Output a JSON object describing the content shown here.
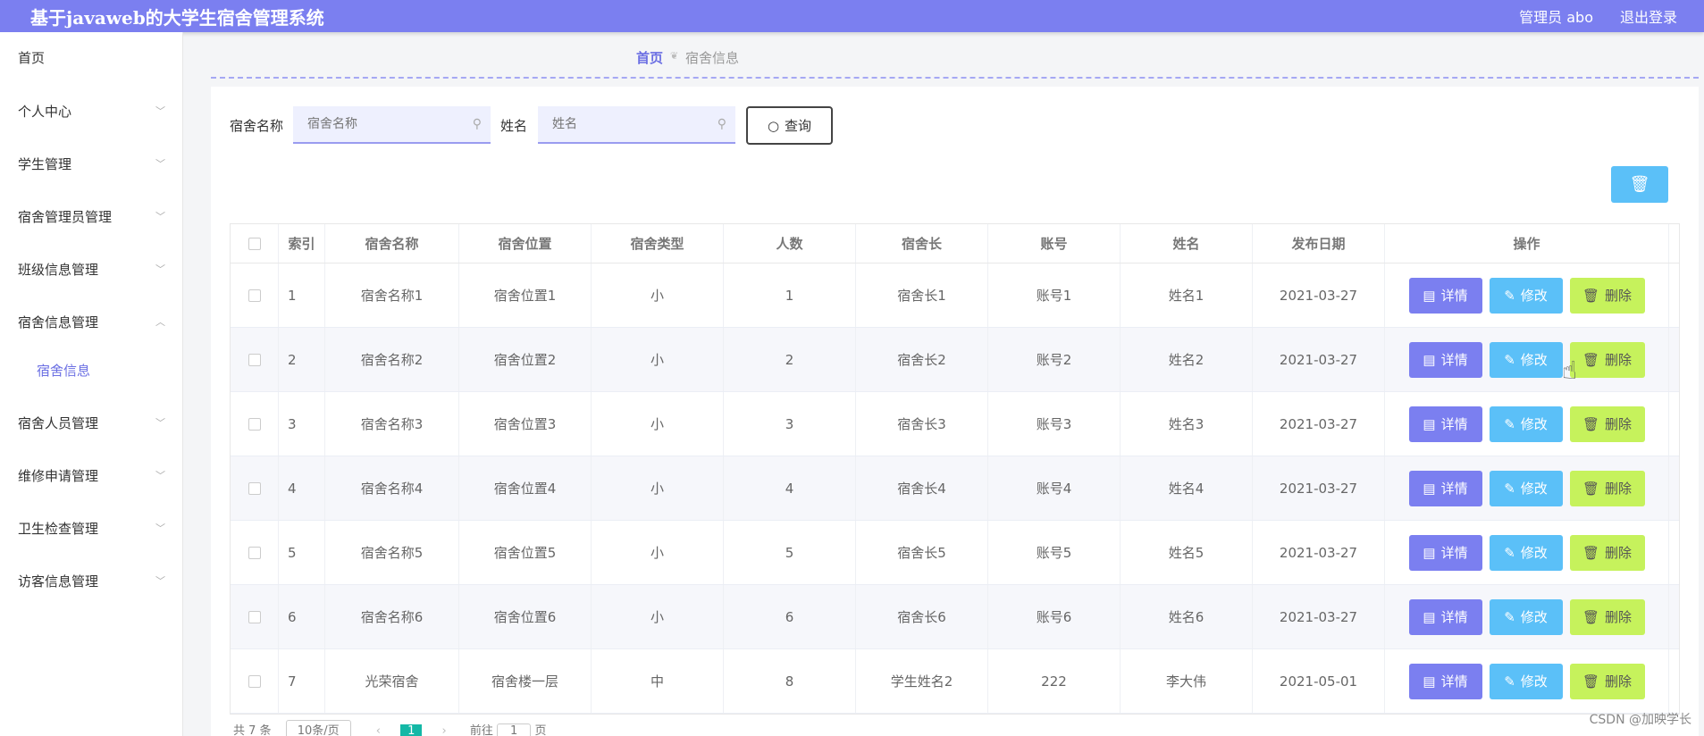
{
  "header": {
    "title": "基于javaweb的大学生宿舍管理系统",
    "user": "管理员 abo",
    "logout": "退出登录"
  },
  "sidebar": {
    "items": [
      {
        "label": "首页"
      },
      {
        "label": "个人中心"
      },
      {
        "label": "学生管理"
      },
      {
        "label": "宿舍管理员管理"
      },
      {
        "label": "班级信息管理"
      },
      {
        "label": "宿舍信息管理"
      },
      {
        "label": "宿舍人员管理"
      },
      {
        "label": "维修申请管理"
      },
      {
        "label": "卫生检查管理"
      },
      {
        "label": "访客信息管理"
      }
    ],
    "submenu": "宿舍信息"
  },
  "breadcrumb": {
    "home": "首页",
    "current": "宿舍信息"
  },
  "search": {
    "name_label": "宿舍名称",
    "name_placeholder": "宿舍名称",
    "person_label": "姓名",
    "person_placeholder": "姓名",
    "query_label": "查询"
  },
  "table": {
    "headers": [
      "索引",
      "宿舍名称",
      "宿舍位置",
      "宿舍类型",
      "人数",
      "宿舍长",
      "账号",
      "姓名",
      "发布日期",
      "操作"
    ],
    "rows": [
      {
        "idx": "1",
        "name": "宿舍名称1",
        "loc": "宿舍位置1",
        "type": "小",
        "count": "1",
        "leader": "宿舍长1",
        "account": "账号1",
        "person": "姓名1",
        "date": "2021-03-27"
      },
      {
        "idx": "2",
        "name": "宿舍名称2",
        "loc": "宿舍位置2",
        "type": "小",
        "count": "2",
        "leader": "宿舍长2",
        "account": "账号2",
        "person": "姓名2",
        "date": "2021-03-27"
      },
      {
        "idx": "3",
        "name": "宿舍名称3",
        "loc": "宿舍位置3",
        "type": "小",
        "count": "3",
        "leader": "宿舍长3",
        "account": "账号3",
        "person": "姓名3",
        "date": "2021-03-27"
      },
      {
        "idx": "4",
        "name": "宿舍名称4",
        "loc": "宿舍位置4",
        "type": "小",
        "count": "4",
        "leader": "宿舍长4",
        "account": "账号4",
        "person": "姓名4",
        "date": "2021-03-27"
      },
      {
        "idx": "5",
        "name": "宿舍名称5",
        "loc": "宿舍位置5",
        "type": "小",
        "count": "5",
        "leader": "宿舍长5",
        "account": "账号5",
        "person": "姓名5",
        "date": "2021-03-27"
      },
      {
        "idx": "6",
        "name": "宿舍名称6",
        "loc": "宿舍位置6",
        "type": "小",
        "count": "6",
        "leader": "宿舍长6",
        "account": "账号6",
        "person": "姓名6",
        "date": "2021-03-27"
      },
      {
        "idx": "7",
        "name": "光荣宿舍",
        "loc": "宿舍楼一层",
        "type": "中",
        "count": "8",
        "leader": "学生姓名2",
        "account": "222",
        "person": "李大伟",
        "date": "2021-05-01"
      }
    ],
    "actions": {
      "detail": "详情",
      "edit": "修改",
      "delete": "删除"
    }
  },
  "pagination": {
    "total": "共 7 条",
    "page_size": "10条/页",
    "current_page": "1",
    "goto_label": "前往",
    "goto_value": "1",
    "page_unit": "页"
  },
  "watermark": "CSDN @加映学长",
  "colors": {
    "primary": "#7b7ff0",
    "info": "#5bc0f8",
    "danger": "#c6f25c"
  },
  "icons": {
    "search": "search-icon",
    "delete": "trash-icon",
    "detail": "document-icon",
    "edit": "pencil-icon"
  }
}
